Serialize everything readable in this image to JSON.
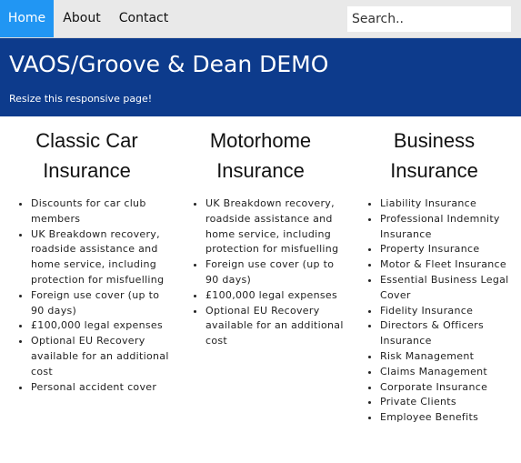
{
  "nav": {
    "items": [
      {
        "label": "Home",
        "active": true
      },
      {
        "label": "About",
        "active": false
      },
      {
        "label": "Contact",
        "active": false
      }
    ],
    "search_placeholder": "Search.."
  },
  "header": {
    "title": "VAOS/Groove & Dean DEMO",
    "subtitle": "Resize this responsive page!"
  },
  "columns": [
    {
      "title": "Classic Car Insurance",
      "items": [
        "Discounts for car club members",
        "UK Breakdown recovery, roadside assistance and home service, including protection for misfuelling",
        "Foreign use cover (up to 90 days)",
        "£100,000 legal expenses",
        "Optional EU Recovery available for an additional cost",
        "Personal accident cover"
      ]
    },
    {
      "title": "Motorhome Insurance",
      "items": [
        "UK Breakdown recovery, roadside assistance and home service, including protection for misfuelling",
        "Foreign use cover (up to 90 days)",
        "£100,000 legal expenses",
        "Optional EU Recovery available for an additional cost"
      ]
    },
    {
      "title": "Business Insurance",
      "items": [
        "Liability Insurance",
        "Professional Indemnity Insurance",
        "Property Insurance",
        "Motor & Fleet Insurance",
        "Essential Business Legal Cover",
        "Fidelity Insurance",
        "Directors & Officers Insurance",
        "Risk Management",
        "Claims Management",
        "Corporate Insurance",
        "Private Clients",
        "Employee Benefits"
      ]
    }
  ],
  "colors": {
    "nav_background": "#e9e9e9",
    "nav_active": "#2196f3",
    "header_background": "#0d3b8c"
  }
}
